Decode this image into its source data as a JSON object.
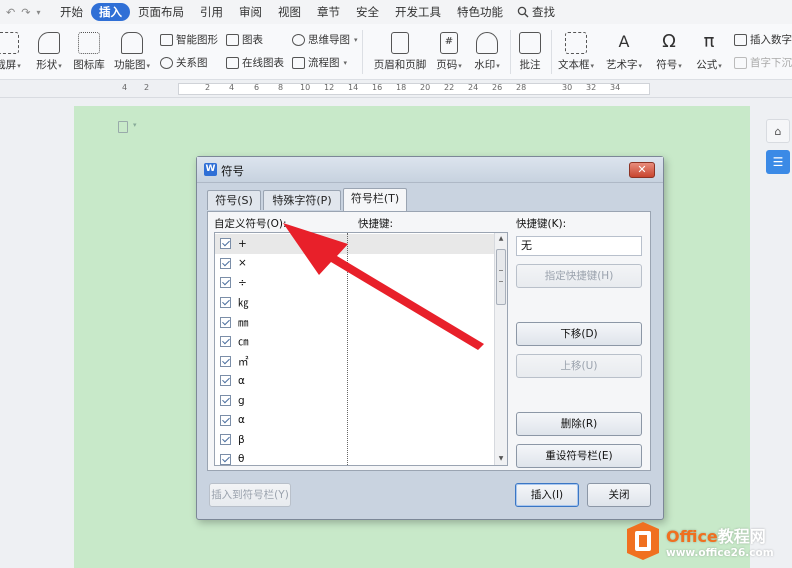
{
  "menubar": {
    "items": [
      "开始",
      "插入",
      "页面布局",
      "引用",
      "审阅",
      "视图",
      "章节",
      "安全",
      "开发工具",
      "特色功能"
    ],
    "active_index": 1,
    "search_label": "查找"
  },
  "ribbon": {
    "screenshot": "截屏",
    "shapes": "形状",
    "icon_lib": "图标库",
    "func_chart": "功能图",
    "smart_art": "智能图形",
    "chart": "图表",
    "mind_map": "思维导图",
    "relation": "关系图",
    "online_chart": "在线图表",
    "flowchart": "流程图",
    "header_footer": "页眉和页脚",
    "page_num": "页码",
    "watermark": "水印",
    "comment": "批注",
    "textbox": "文本框",
    "wordart": "艺术字",
    "symbol": "符号",
    "formula": "公式",
    "insert_number": "插入数字",
    "drop_cap": "首字下沉"
  },
  "ruler": {
    "ticks": [
      "4",
      "2",
      "2",
      "4",
      "6",
      "8",
      "10",
      "12",
      "14",
      "16",
      "18",
      "20",
      "22",
      "24",
      "26",
      "28",
      "30",
      "32",
      "34"
    ]
  },
  "dialog": {
    "title": "符号",
    "close_label": "✕",
    "tabs": [
      "符号(S)",
      "特殊字符(P)",
      "符号栏(T)"
    ],
    "active_tab": 2,
    "list_header": "自定义符号(O):",
    "shortcut_col_header": "快捷键:",
    "symbols": [
      "+",
      "×",
      "÷",
      "㎏",
      "㎜",
      "㎝",
      "㎡",
      "α",
      "g",
      "α",
      "β",
      "θ"
    ],
    "shortcut_label": "快捷键(K):",
    "shortcut_value": "无",
    "buttons": {
      "assign": "指定快捷键(H)",
      "move_down": "下移(D)",
      "move_up": "上移(U)",
      "delete": "删除(R)",
      "reset": "重设符号栏(E)",
      "insert_to_bar": "插入到符号栏(Y)",
      "insert": "插入(I)",
      "close": "关闭"
    }
  },
  "watermark": {
    "brand_a": "Office",
    "brand_b": "教程网",
    "url": "www.office26.com"
  },
  "colors": {
    "accent": "#2f6fd6",
    "document_bg": "#c8e9c9",
    "arrow": "#e8202a",
    "watermark_orange": "#f07020"
  }
}
